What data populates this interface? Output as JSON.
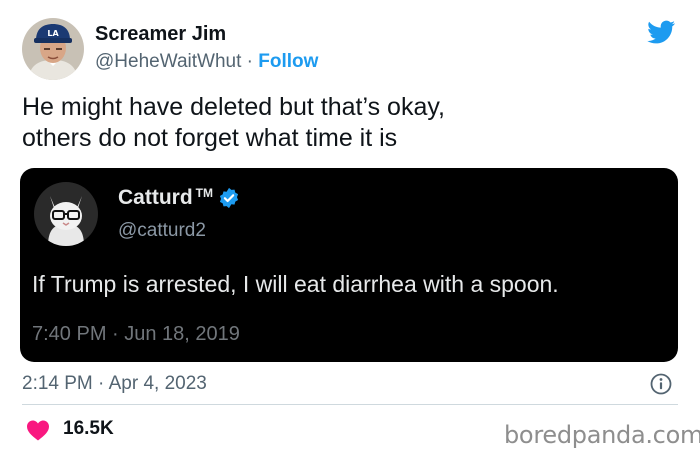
{
  "author": {
    "name": "Screamer Jim",
    "handle": "@HeheWaitWhut",
    "separator": "·",
    "follow_label": "Follow",
    "avatar_icon": "baseball-player-avatar"
  },
  "tweet": {
    "text_lines": [
      "He might have deleted but that’s okay,",
      "others do not forget what time it is"
    ],
    "timestamp": "2:14 PM · Apr 4, 2023"
  },
  "embedded_tweet": {
    "name": "Catturd",
    "trademark": "TM",
    "verified": true,
    "handle": "@catturd2",
    "text": "If Trump is arrested, I will eat diarrhea with a spoon.",
    "timestamp": "7:40 PM · Jun 18, 2019",
    "avatar_icon": "cat-with-glasses-avatar"
  },
  "engagement": {
    "likes": "16.5K"
  },
  "watermark": "boredpanda.com",
  "colors": {
    "twitter_blue": "#1d9bf0",
    "like_red": "#f91880",
    "embed_bg": "#000000",
    "secondary_text": "#536471"
  },
  "icons": [
    "twitter-bird-icon",
    "verified-badge-icon",
    "info-icon",
    "heart-icon"
  ]
}
